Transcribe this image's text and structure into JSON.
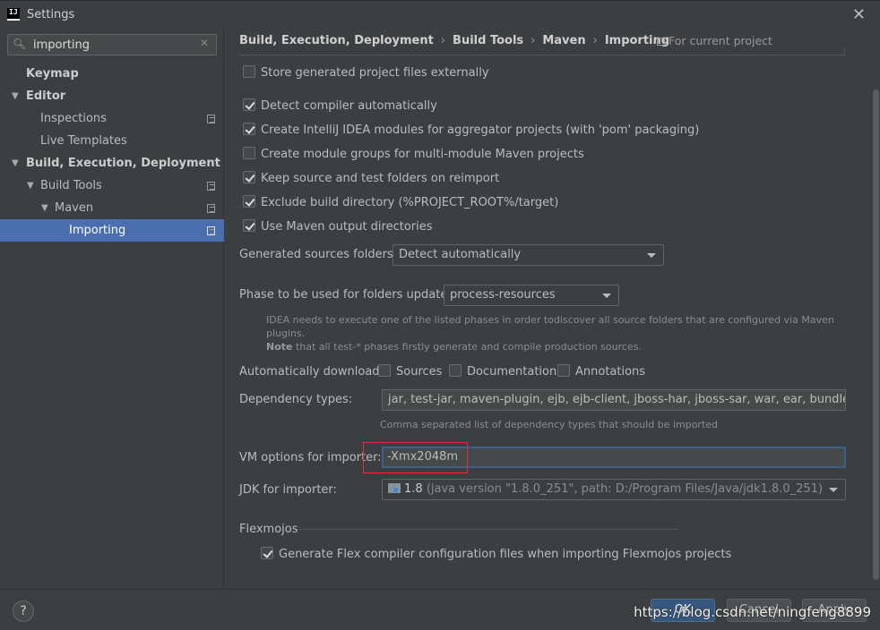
{
  "window": {
    "title": "Settings"
  },
  "sidebar": {
    "search": {
      "value": "importing"
    },
    "items": [
      {
        "label": "Keymap"
      },
      {
        "label": "Editor"
      },
      {
        "label": "Inspections"
      },
      {
        "label": "Live Templates"
      },
      {
        "label": "Build, Execution, Deployment"
      },
      {
        "label": "Build Tools"
      },
      {
        "label": "Maven"
      },
      {
        "label": "Importing"
      }
    ]
  },
  "header": {
    "breadcrumb": [
      "Build, Execution, Deployment",
      "Build Tools",
      "Maven",
      "Importing"
    ],
    "scope": "For current project"
  },
  "options": {
    "store_external": {
      "label": "Store generated project files externally",
      "checked": false
    },
    "checkboxes": [
      {
        "label": "Detect compiler automatically",
        "checked": true
      },
      {
        "label": "Create IntelliJ IDEA modules for aggregator projects (with 'pom' packaging)",
        "checked": true
      },
      {
        "label": "Create module groups for multi-module Maven projects",
        "checked": false
      },
      {
        "label": "Keep source and test folders on reimport",
        "checked": true
      },
      {
        "label": "Exclude build directory (%PROJECT_ROOT%/target)",
        "checked": true
      },
      {
        "label": "Use Maven output directories",
        "checked": true
      }
    ],
    "generated_sources": {
      "label": "Generated sources folders:",
      "value": "Detect automatically"
    },
    "phase": {
      "label": "Phase to be used for folders update:",
      "value": "process-resources",
      "hint_line1": "IDEA needs to execute one of the listed phases in order todiscover all source folders that are configured via Maven plugins.",
      "hint_note_bold": "Note",
      "hint_note_rest": " that all test-* phases firstly generate and compile production sources."
    },
    "auto_download": {
      "label": "Automatically download:",
      "sources": "Sources",
      "documentation": "Documentation",
      "annotations": "Annotations"
    },
    "dependency_types": {
      "label": "Dependency types:",
      "value": "jar, test-jar, maven-plugin, ejb, ejb-client, jboss-har, jboss-sar, war, ear, bundle",
      "hint": "Comma separated list of dependency types that should be imported"
    },
    "vm_options": {
      "label": "VM options for importer:",
      "value": "-Xmx2048m"
    },
    "jdk": {
      "label": "JDK for importer:",
      "version": "1.8",
      "detail": " (java version \"1.8.0_251\", path: D:/Program Files/Java/jdk1.8.0_251)"
    },
    "flexmojos": {
      "title": "Flexmojos",
      "checkbox_label": "Generate Flex compiler configuration files when importing Flexmojos projects",
      "checked": true
    }
  },
  "footer": {
    "help": "?",
    "ok": "OK",
    "cancel": "Cancel",
    "apply": "Apply",
    "watermark": "https://blog.csdn.net/ningfeng8899"
  },
  "colors": {
    "background": "#3c3f41",
    "selection": "#4b6eaf",
    "focus_border": "#3d6185",
    "highlight_box": "#e0303a"
  }
}
